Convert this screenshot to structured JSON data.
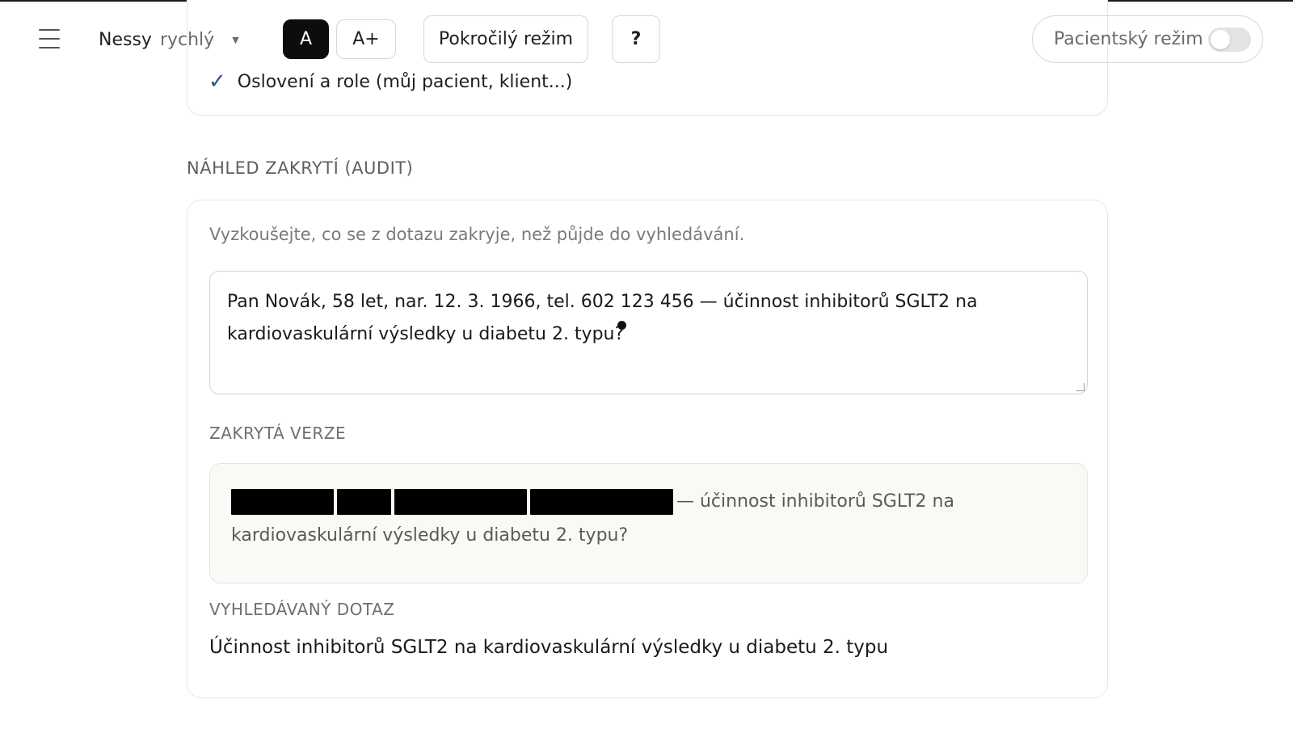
{
  "header": {
    "model_name": "Nessy",
    "model_speed": "rychlý",
    "font_size_normal_label": "A",
    "font_size_large_label": "A+",
    "advanced_mode_label": "Pokročilý režim",
    "help_label": "?",
    "patient_mode_label": "Pacientský režim",
    "patient_mode_enabled": false
  },
  "settings": {
    "checked_item_label": "Oslovení a role (můj pacient, klient...)"
  },
  "audit": {
    "section_title": "NÁHLED ZAKRYTÍ (AUDIT)",
    "hint": "Vyzkoušejte, co se z dotazu zakryje, než půjde do vyhledávání.",
    "input_value": "Pan  Novák, 58 let, nar. 12. 3. 1966, tel. 602 123 456 — účinnost inhibitorů SGLT2 na kardiovaskulární výsledky u diabetu 2. typu?",
    "masked_label": "ZAKRYTÁ VERZE",
    "masked_text": "— účinnost inhibitorů SGLT2 na kardiovaskulární výsledky u diabetu 2. typu?",
    "redacted_block_count": 4,
    "query_label": "VYHLEDÁVANÝ DOTAZ",
    "query_text": "Účinnost inhibitorů SGLT2 na kardiovaskulární výsledky u diabetu 2. typu"
  },
  "colors": {
    "accent_check": "#2f4f86",
    "active_button_bg": "#0d0d0d",
    "masked_bg": "#faf9f6",
    "redaction": "#000000"
  },
  "icons": {
    "menu": "hamburger-icon",
    "dropdown": "caret-down-icon",
    "check": "check-icon"
  }
}
